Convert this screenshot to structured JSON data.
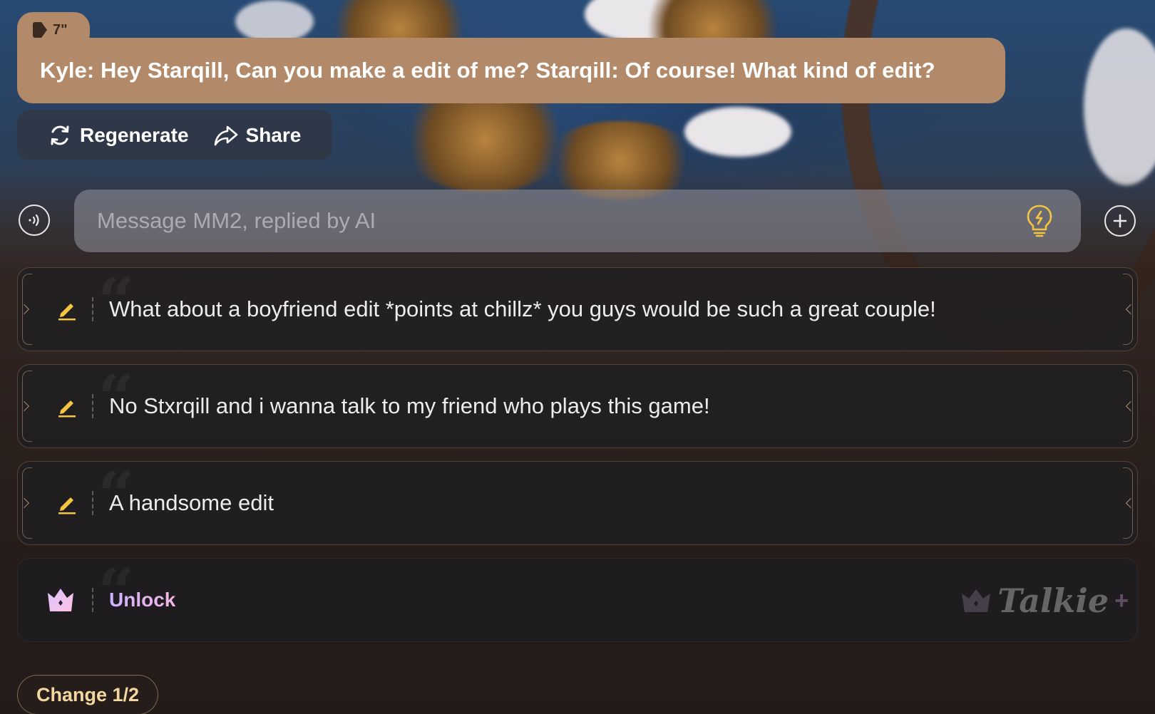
{
  "message": {
    "duration": "7\"",
    "text": "Kyle: Hey Starqill, Can you make a edit of me? Starqill: Of course! What kind of edit?"
  },
  "actions": {
    "regenerate_label": "Regenerate",
    "share_label": "Share"
  },
  "composer": {
    "placeholder": "Message MM2, replied by AI",
    "voice_icon": "voice-wave-icon",
    "hint_icon": "lightbulb-icon",
    "add_icon": "plus-circle-icon"
  },
  "suggestions": [
    {
      "text": "What about a boyfriend edit *points at chillz* you guys would be such a great couple!",
      "icon": "pencil-icon"
    },
    {
      "text": "No Stxrqill and i wanna talk to my friend who plays this game!",
      "icon": "pencil-icon"
    },
    {
      "text": "A handsome edit",
      "icon": "pencil-icon"
    }
  ],
  "unlock": {
    "label": "Unlock",
    "icon": "crown-icon",
    "brand": "Talkie",
    "brand_suffix": "+"
  },
  "change": {
    "label": "Change 1/2"
  },
  "colors": {
    "bubble": "#b28a6a",
    "pencil_accent": "#f5c542",
    "change_text": "#f4d7a0"
  }
}
